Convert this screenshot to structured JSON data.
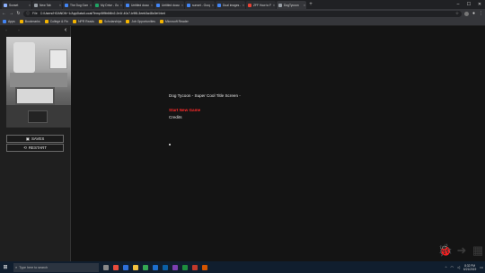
{
  "browser": {
    "tabs": [
      {
        "label": "Sunset",
        "color": "#8fb3ff"
      },
      {
        "label": "New Tab",
        "color": "#9aa0a6"
      },
      {
        "label": "The Dog Game - Goog",
        "color": "#4285f4"
      },
      {
        "label": "My Drive - Google Dr",
        "color": "#1fa463"
      },
      {
        "label": "Untitled document",
        "color": "#4285f4"
      },
      {
        "label": "Untitled document -",
        "color": "#4285f4"
      },
      {
        "label": "sunset - Google Sea",
        "color": "#4285f4"
      },
      {
        "label": "Dual images - Goog",
        "color": "#4285f4"
      },
      {
        "label": "ZFF How to Fix a Ph",
        "color": "#ea4335"
      },
      {
        "label": "DogTycoon",
        "color": "#9aa0a6"
      }
    ],
    "omnibox": {
      "label": "File",
      "url": "C:/Users/HOANDN~1/AppData/Local/Temp/8f9b6f4b2-2e1f-40c7-b9f8-3eeb3a48c0ef.html"
    },
    "bookmarks": [
      {
        "label": "Apps",
        "color": "#4285f4"
      },
      {
        "label": "Bookmarks",
        "color": "#f4b400"
      },
      {
        "label": "College & Fin",
        "color": "#f4b400"
      },
      {
        "label": "NPR Reads",
        "color": "#f4b400"
      },
      {
        "label": "Scholarships",
        "color": "#f4b400"
      },
      {
        "label": "Job Opportunities",
        "color": "#f4b400"
      },
      {
        "label": "Microsoft Reader",
        "color": "#f4b400"
      }
    ]
  },
  "sidebar": {
    "saves_label": "SAVES",
    "restart_label": "RESTART"
  },
  "game": {
    "title": "Dog Tycoon - Super Cool Title Screen -",
    "start_label": "Start New Game",
    "credits_label": "Credits"
  },
  "taskbar": {
    "search_placeholder": "Type here to search",
    "time": "8:32 PM",
    "date": "6/21/2019"
  }
}
